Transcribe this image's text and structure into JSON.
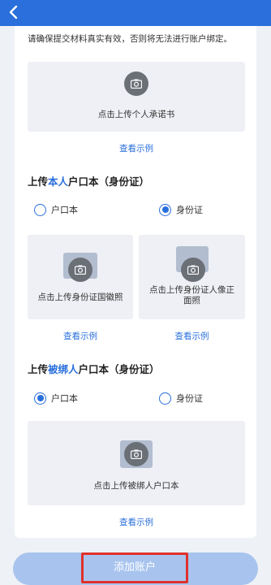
{
  "notice": "请确保提交材料真实有效，否则将无法进行账户绑定。",
  "promise": {
    "caption": "点击上传个人承诺书",
    "example": "查看示例"
  },
  "self_section": {
    "title_prefix": "上传",
    "title_highlight": "本人",
    "title_suffix": "户口本（身份证）",
    "options": [
      "户口本",
      "身份证"
    ],
    "selected": "身份证",
    "front_caption": "点击上传身份证国徽照",
    "back_caption": "点击上传身份证人像正面照",
    "example_left": "查看示例",
    "example_right": "查看示例"
  },
  "bound_section": {
    "title_prefix": "上传",
    "title_highlight": "被绑人",
    "title_suffix": "户口本（身份证）",
    "options": [
      "户口本",
      "身份证"
    ],
    "selected": "户口本",
    "caption": "点击上传被绑人户口本",
    "example": "查看示例"
  },
  "submit_label": "添加账户",
  "colors": {
    "accent": "#2a6fdb",
    "button_bg": "#a8c4ee",
    "highlight_border": "#e0302b"
  },
  "icons": {
    "back": "chevron-left-icon",
    "camera": "camera-icon"
  }
}
